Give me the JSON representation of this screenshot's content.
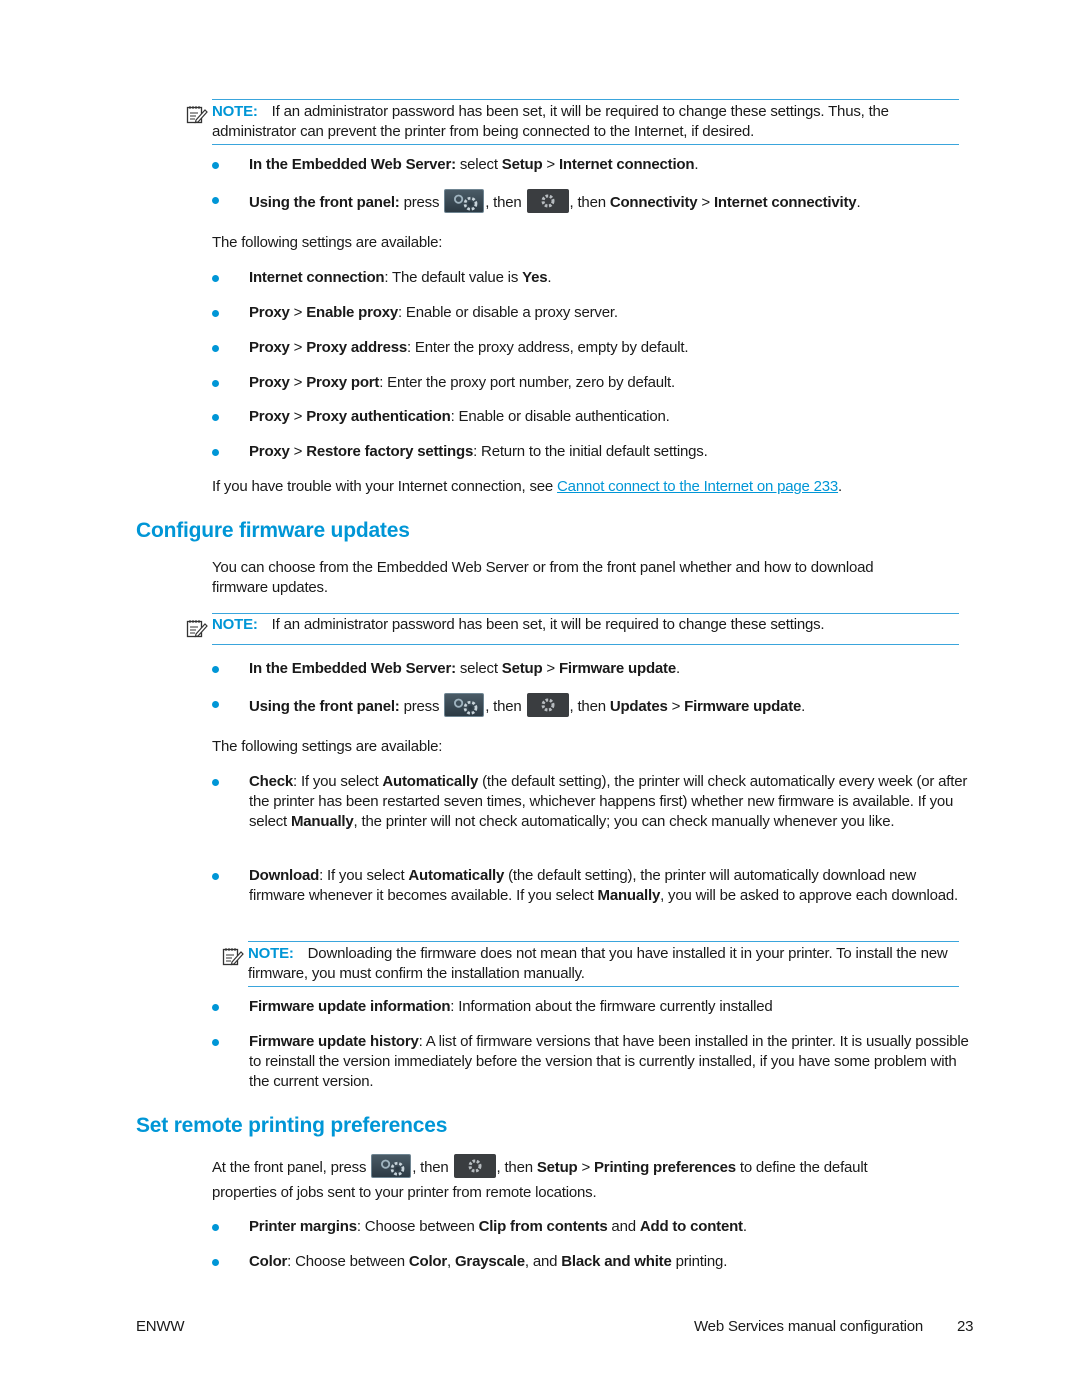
{
  "notes": {
    "label": "NOTE:",
    "note1": "If an administrator password has been set, it will be required to change these settings. Thus, the administrator can prevent the printer from being connected to the Internet, if desired.",
    "note2": "If an administrator password has been set, it will be required to change these settings.",
    "note3": "Downloading the firmware does not mean that you have installed it in your printer. To install the new firmware, you must confirm the installation manually."
  },
  "section1": {
    "ews": {
      "b1": "In the Embedded Web Server:",
      "t1": " select ",
      "b2": "Setup",
      "t2": " > ",
      "b3": "Internet connection",
      "t3": "."
    },
    "fp": {
      "b1": "Using the front panel:",
      "t1": " press ",
      "t2": ", then ",
      "t3": ", then ",
      "b2": "Connectivity",
      "t4": " > ",
      "b3": "Internet connectivity",
      "t5": "."
    },
    "following": "The following settings are available:",
    "settings": [
      {
        "parts": [
          {
            "b": "Internet connection"
          },
          {
            "t": ": The default value is "
          },
          {
            "b": "Yes"
          },
          {
            "t": "."
          }
        ]
      },
      {
        "parts": [
          {
            "b": "Proxy"
          },
          {
            "t": " > "
          },
          {
            "b": "Enable proxy"
          },
          {
            "t": ": Enable or disable a proxy server."
          }
        ]
      },
      {
        "parts": [
          {
            "b": "Proxy"
          },
          {
            "t": " > "
          },
          {
            "b": "Proxy address"
          },
          {
            "t": ": Enter the proxy address, empty by default."
          }
        ]
      },
      {
        "parts": [
          {
            "b": "Proxy"
          },
          {
            "t": " > "
          },
          {
            "b": "Proxy port"
          },
          {
            "t": ": Enter the proxy port number, zero by default."
          }
        ]
      },
      {
        "parts": [
          {
            "b": "Proxy"
          },
          {
            "t": " > "
          },
          {
            "b": "Proxy authentication"
          },
          {
            "t": ": Enable or disable authentication."
          }
        ]
      },
      {
        "parts": [
          {
            "b": "Proxy"
          },
          {
            "t": " > "
          },
          {
            "b": "Restore factory settings"
          },
          {
            "t": ": Return to the initial default settings."
          }
        ]
      }
    ],
    "trouble_pre": "If you have trouble with your Internet connection, see ",
    "trouble_link": "Cannot connect to the Internet on page 233",
    "trouble_post": "."
  },
  "section2": {
    "heading": "Configure firmware updates",
    "intro": "You can choose from the Embedded Web Server or from the front panel whether and how to download firmware updates.",
    "ews": {
      "b1": "In the Embedded Web Server:",
      "t1": " select ",
      "b2": "Setup",
      "t2": " > ",
      "b3": "Firmware update",
      "t3": "."
    },
    "fp": {
      "b1": "Using the front panel:",
      "t1": " press ",
      "t2": ", then ",
      "t3": ", then ",
      "b2": "Updates",
      "t4": " > ",
      "b3": "Firmware update",
      "t5": "."
    },
    "following": "The following settings are available:",
    "settings": [
      {
        "parts": [
          {
            "b": "Check"
          },
          {
            "t": ": If you select "
          },
          {
            "b": "Automatically"
          },
          {
            "t": " (the default setting), the printer will check automatically every week (or after the printer has been restarted seven times, whichever happens first) whether new firmware is available. If you select "
          },
          {
            "b": "Manually"
          },
          {
            "t": ", the printer will not check automatically; you can check manually whenever you like."
          }
        ]
      },
      {
        "parts": [
          {
            "b": "Download"
          },
          {
            "t": ": If you select "
          },
          {
            "b": "Automatically"
          },
          {
            "t": " (the default setting), the printer will automatically download new firmware whenever it becomes available. If you select "
          },
          {
            "b": "Manually"
          },
          {
            "t": ", you will be asked to approve each download."
          }
        ]
      }
    ],
    "settings2": [
      {
        "parts": [
          {
            "b": "Firmware update information"
          },
          {
            "t": ": Information about the firmware currently installed"
          }
        ]
      },
      {
        "parts": [
          {
            "b": "Firmware update history"
          },
          {
            "t": ": A list of firmware versions that have been installed in the printer. It is usually possible to reinstall the version immediately before the version that is currently installed, if you have some problem with the current version."
          }
        ]
      }
    ]
  },
  "section3": {
    "heading": "Set remote printing preferences",
    "intro": {
      "t1": "At the front panel, press ",
      "t2": ", then ",
      "t3": ", then ",
      "b1": "Setup",
      "t4": " > ",
      "b2": "Printing preferences",
      "t5": " to define the default properties of jobs sent to your printer from remote locations."
    },
    "settings": [
      {
        "parts": [
          {
            "b": "Printer margins"
          },
          {
            "t": ": Choose between "
          },
          {
            "b": "Clip from contents"
          },
          {
            "t": " and "
          },
          {
            "b": "Add to content"
          },
          {
            "t": "."
          }
        ]
      },
      {
        "parts": [
          {
            "b": "Color"
          },
          {
            "t": ": Choose between "
          },
          {
            "b": "Color"
          },
          {
            "t": ", "
          },
          {
            "b": "Grayscale"
          },
          {
            "t": ", and "
          },
          {
            "b": "Black and white"
          },
          {
            "t": " printing."
          }
        ]
      }
    ]
  },
  "footer": {
    "left": "ENWW",
    "section": "Web Services manual configuration",
    "page": "23"
  },
  "colors": {
    "accent": "#0096d6",
    "text": "#1a1a1a"
  }
}
